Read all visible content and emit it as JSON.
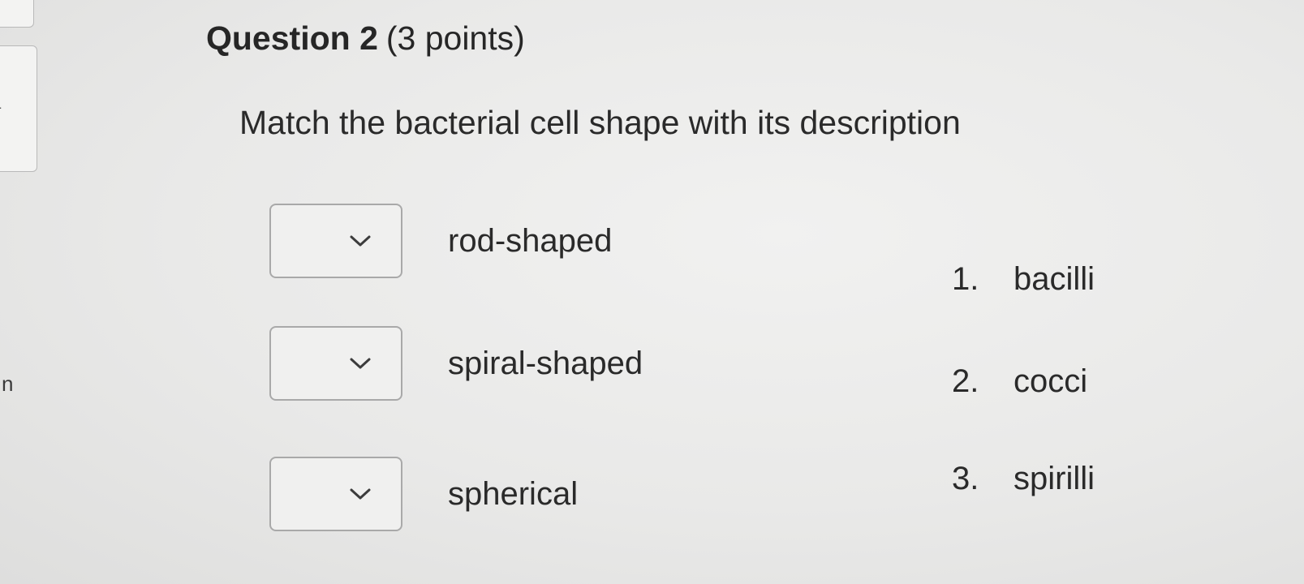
{
  "sidebar": {
    "partial_letter": "n"
  },
  "question": {
    "title": "Question 2",
    "points": "(3 points)",
    "prompt": "Match the bacterial cell shape with its description"
  },
  "matches": [
    {
      "label": "rod-shaped",
      "selected": ""
    },
    {
      "label": "spiral-shaped",
      "selected": ""
    },
    {
      "label": "spherical",
      "selected": ""
    }
  ],
  "answers": [
    {
      "number": "1.",
      "text": "bacilli"
    },
    {
      "number": "2.",
      "text": "cocci"
    },
    {
      "number": "3.",
      "text": "spirilli"
    }
  ],
  "icons": {
    "dropdown": "chevron-down-icon"
  }
}
